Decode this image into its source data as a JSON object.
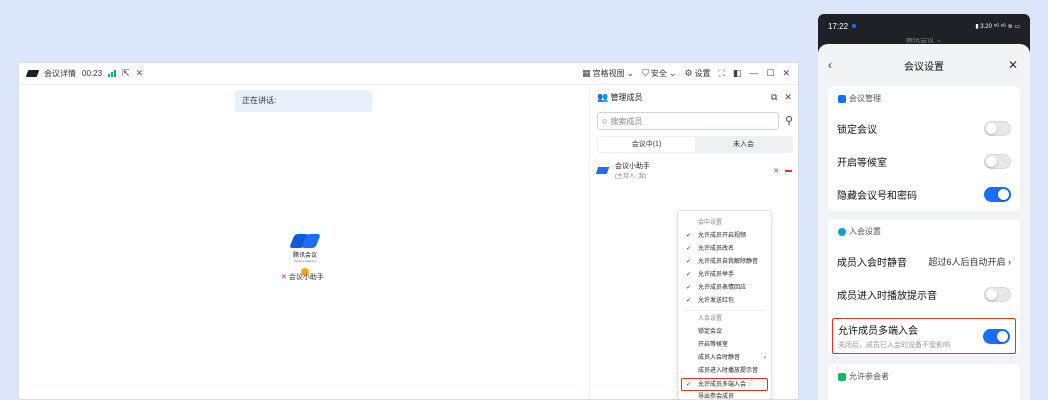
{
  "window": {
    "meeting_info_label": "会议详情",
    "duration": "00:23",
    "layout_label": "宫格视图",
    "security_label": "安全",
    "settings_label": "设置"
  },
  "stage": {
    "speaking_label": "正在讲话:",
    "brand_name": "腾讯会议",
    "brand_sub": "Tencent Meeting",
    "assistant_name": "会议小助手"
  },
  "panel": {
    "title": "管理成员",
    "search_placeholder": "搜索成员",
    "tab_in_meeting": "会议中(1)",
    "tab_not_joined": "未入会",
    "member_name": "会议小助手",
    "member_role": "(主持人, 我)"
  },
  "menu": {
    "section_in_meeting": "会中设置",
    "items_in_meeting": [
      "允许成员开启视频",
      "允许成员改名",
      "允许成员自我解除静音",
      "允许成员举手",
      "允许成员表情回应",
      "允许发送红包"
    ],
    "section_join": "入会设置",
    "item_lock": "锁定会议",
    "item_waiting": "开启等候室",
    "item_mute_on_join": "成员入会时静音",
    "item_join_sound": "成员进入时播放提示音",
    "item_multi_device": "允许成员多端入会",
    "item_export": "导出参会成员"
  },
  "phone": {
    "time": "17:22",
    "status_right": "▮ 3.20 ⁵ᴳ ᵉᴳ ≋ ▭",
    "behind_title": "腾讯会议 ⌄",
    "sheet_title": "会议设置",
    "card1_title": "会议管理",
    "lock_label": "锁定会议",
    "waiting_label": "开启等候室",
    "hide_label": "隐藏会议号和密码",
    "card2_title": "入会设置",
    "mute_label": "成员入会时静音",
    "mute_value": "超过6人后自动开启",
    "sound_label": "成员进入时播放提示音",
    "multi_label": "允许成员多端入会",
    "multi_desc": "关闭后，成员已入会的设备不受影响",
    "card3_title": "允许参会者"
  },
  "colors": {
    "accent": "#1a6dff",
    "highlight": "#e3332d",
    "background": "#dce6fb"
  }
}
